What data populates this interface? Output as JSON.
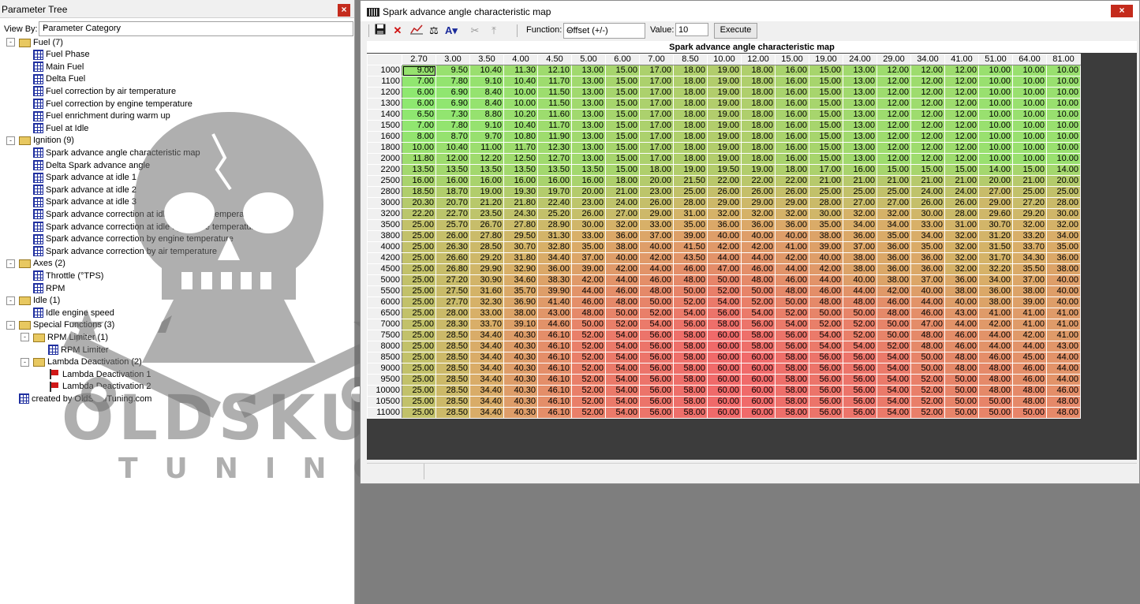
{
  "left_pane": {
    "title": "Parameter Tree",
    "view_by_label": "View By:",
    "view_by_value": "Parameter Category",
    "tree": [
      {
        "label": "Fuel (7)",
        "icon": "folder-icon",
        "level": 0,
        "toggle": "-"
      },
      {
        "label": "Fuel Phase",
        "icon": "map-grid-icon",
        "level": 1
      },
      {
        "label": "Main Fuel",
        "icon": "map-grid-icon",
        "level": 1
      },
      {
        "label": "Delta Fuel",
        "icon": "map-grid-icon",
        "level": 1
      },
      {
        "label": "Fuel correction by air temperature",
        "icon": "map-grid-icon",
        "level": 1
      },
      {
        "label": "Fuel correction by engine temperature",
        "icon": "map-grid-icon",
        "level": 1
      },
      {
        "label": "Fuel enrichment during warm up",
        "icon": "map-grid-icon",
        "level": 1
      },
      {
        "label": "Fuel at Idle",
        "icon": "map-grid-icon",
        "level": 1
      },
      {
        "label": "Ignition (9)",
        "icon": "folder-icon",
        "level": 0,
        "toggle": "-"
      },
      {
        "label": "Spark advance angle characteristic map",
        "icon": "map-grid-icon",
        "level": 1
      },
      {
        "label": "Delta Spark advance angle",
        "icon": "map-grid-icon",
        "level": 1
      },
      {
        "label": "Spark advance at idle 1",
        "icon": "map-grid-icon",
        "level": 1
      },
      {
        "label": "Spark advance at idle 2",
        "icon": "map-grid-icon",
        "level": 1
      },
      {
        "label": "Spark advance at idle 3",
        "icon": "map-grid-icon",
        "level": 1
      },
      {
        "label": "Spark advance correction at idle by engine temperature 1",
        "icon": "map-grid-icon",
        "level": 1
      },
      {
        "label": "Spark advance correction at idle by engine temperature 2",
        "icon": "map-grid-icon",
        "level": 1
      },
      {
        "label": "Spark advance correction by engine temperature",
        "icon": "map-grid-icon",
        "level": 1
      },
      {
        "label": "Spark advance correction by air temperature",
        "icon": "map-grid-icon",
        "level": 1
      },
      {
        "label": "Axes (2)",
        "icon": "folder-icon",
        "level": 0,
        "toggle": "-"
      },
      {
        "label": "Throttle (°TPS)",
        "icon": "map-grid-icon",
        "level": 1
      },
      {
        "label": "RPM",
        "icon": "map-grid-icon",
        "level": 1
      },
      {
        "label": "Idle (1)",
        "icon": "folder-icon",
        "level": 0,
        "toggle": "-"
      },
      {
        "label": "Idle engine speed",
        "icon": "map-grid-icon",
        "level": 1
      },
      {
        "label": "Special Functions (3)",
        "icon": "folder-icon",
        "level": 0,
        "toggle": "-"
      },
      {
        "label": "RPM Limiter (1)",
        "icon": "folder-icon",
        "level": 1,
        "toggle": "-"
      },
      {
        "label": "RPM Limiter",
        "icon": "map-grid-icon",
        "level": 2
      },
      {
        "label": "Lambda Deactivation (2)",
        "icon": "folder-icon",
        "level": 1,
        "toggle": "-"
      },
      {
        "label": "Lambda Deactivation 1",
        "icon": "red-flag-icon",
        "level": 2
      },
      {
        "label": "Lambda Deactivation 2",
        "icon": "red-flag-icon",
        "level": 2
      },
      {
        "label": "created by OldSkullTuning.com",
        "icon": "map-grid-icon",
        "level": 0
      }
    ],
    "watermark_letters": "OLDSKULL",
    "watermark_sub": "TUNING"
  },
  "map_window": {
    "title": "Spark advance angle characteristic map",
    "function_label": "Function:",
    "function_value": "Offset (+/-)",
    "value_label": "Value:",
    "value_input": "10",
    "execute_label": "Execute",
    "toolbar_icons": [
      "save-icon",
      "delete-icon",
      "graph-icon",
      "balance-icon",
      "text-tool-icon",
      "cut-icon",
      "interpolate-icon"
    ],
    "map_title": "Spark advance angle characteristic map",
    "x_axis": [
      "2.70",
      "3.00",
      "3.50",
      "4.00",
      "4.50",
      "5.00",
      "6.00",
      "7.00",
      "8.50",
      "10.00",
      "12.00",
      "15.00",
      "19.00",
      "24.00",
      "29.00",
      "34.00",
      "41.00",
      "51.00",
      "64.00",
      "81.00"
    ],
    "y_axis": [
      "1000",
      "1100",
      "1200",
      "1300",
      "1400",
      "1500",
      "1600",
      "1800",
      "2000",
      "2200",
      "2500",
      "2800",
      "3000",
      "3200",
      "3500",
      "3800",
      "4000",
      "4200",
      "4500",
      "5000",
      "5500",
      "6000",
      "6500",
      "7000",
      "7500",
      "8000",
      "8500",
      "9000",
      "9500",
      "10000",
      "10500",
      "11000"
    ],
    "values": [
      [
        "9.00",
        "9.50",
        "10.40",
        "11.30",
        "12.10",
        "13.00",
        "15.00",
        "17.00",
        "18.00",
        "19.00",
        "18.00",
        "16.00",
        "15.00",
        "13.00",
        "12.00",
        "12.00",
        "12.00",
        "10.00",
        "10.00",
        "10.00"
      ],
      [
        "7.00",
        "7.80",
        "9.10",
        "10.40",
        "11.70",
        "13.00",
        "15.00",
        "17.00",
        "18.00",
        "19.00",
        "18.00",
        "16.00",
        "15.00",
        "13.00",
        "12.00",
        "12.00",
        "12.00",
        "10.00",
        "10.00",
        "10.00"
      ],
      [
        "6.00",
        "6.90",
        "8.40",
        "10.00",
        "11.50",
        "13.00",
        "15.00",
        "17.00",
        "18.00",
        "19.00",
        "18.00",
        "16.00",
        "15.00",
        "13.00",
        "12.00",
        "12.00",
        "12.00",
        "10.00",
        "10.00",
        "10.00"
      ],
      [
        "6.00",
        "6.90",
        "8.40",
        "10.00",
        "11.50",
        "13.00",
        "15.00",
        "17.00",
        "18.00",
        "19.00",
        "18.00",
        "16.00",
        "15.00",
        "13.00",
        "12.00",
        "12.00",
        "12.00",
        "10.00",
        "10.00",
        "10.00"
      ],
      [
        "6.50",
        "7.30",
        "8.80",
        "10.20",
        "11.60",
        "13.00",
        "15.00",
        "17.00",
        "18.00",
        "19.00",
        "18.00",
        "16.00",
        "15.00",
        "13.00",
        "12.00",
        "12.00",
        "12.00",
        "10.00",
        "10.00",
        "10.00"
      ],
      [
        "7.00",
        "7.80",
        "9.10",
        "10.40",
        "11.70",
        "13.00",
        "15.00",
        "17.00",
        "18.00",
        "19.00",
        "18.00",
        "16.00",
        "15.00",
        "13.00",
        "12.00",
        "12.00",
        "12.00",
        "10.00",
        "10.00",
        "10.00"
      ],
      [
        "8.00",
        "8.70",
        "9.70",
        "10.80",
        "11.90",
        "13.00",
        "15.00",
        "17.00",
        "18.00",
        "19.00",
        "18.00",
        "16.00",
        "15.00",
        "13.00",
        "12.00",
        "12.00",
        "12.00",
        "10.00",
        "10.00",
        "10.00"
      ],
      [
        "10.00",
        "10.40",
        "11.00",
        "11.70",
        "12.30",
        "13.00",
        "15.00",
        "17.00",
        "18.00",
        "19.00",
        "18.00",
        "16.00",
        "15.00",
        "13.00",
        "12.00",
        "12.00",
        "12.00",
        "10.00",
        "10.00",
        "10.00"
      ],
      [
        "11.80",
        "12.00",
        "12.20",
        "12.50",
        "12.70",
        "13.00",
        "15.00",
        "17.00",
        "18.00",
        "19.00",
        "18.00",
        "16.00",
        "15.00",
        "13.00",
        "12.00",
        "12.00",
        "12.00",
        "10.00",
        "10.00",
        "10.00"
      ],
      [
        "13.50",
        "13.50",
        "13.50",
        "13.50",
        "13.50",
        "13.50",
        "15.00",
        "18.00",
        "19.00",
        "19.50",
        "19.00",
        "18.00",
        "17.00",
        "16.00",
        "15.00",
        "15.00",
        "15.00",
        "14.00",
        "15.00",
        "14.00"
      ],
      [
        "16.00",
        "16.00",
        "16.00",
        "16.00",
        "16.00",
        "16.00",
        "18.00",
        "20.00",
        "21.50",
        "22.00",
        "22.00",
        "22.00",
        "21.00",
        "21.00",
        "21.00",
        "21.00",
        "21.00",
        "20.00",
        "21.00",
        "20.00"
      ],
      [
        "18.50",
        "18.70",
        "19.00",
        "19.30",
        "19.70",
        "20.00",
        "21.00",
        "23.00",
        "25.00",
        "26.00",
        "26.00",
        "26.00",
        "25.00",
        "25.00",
        "25.00",
        "24.00",
        "24.00",
        "27.00",
        "25.00",
        "25.00"
      ],
      [
        "20.30",
        "20.70",
        "21.20",
        "21.80",
        "22.40",
        "23.00",
        "24.00",
        "26.00",
        "28.00",
        "29.00",
        "29.00",
        "29.00",
        "28.00",
        "27.00",
        "27.00",
        "26.00",
        "26.00",
        "29.00",
        "27.20",
        "28.00"
      ],
      [
        "22.20",
        "22.70",
        "23.50",
        "24.30",
        "25.20",
        "26.00",
        "27.00",
        "29.00",
        "31.00",
        "32.00",
        "32.00",
        "32.00",
        "30.00",
        "32.00",
        "32.00",
        "30.00",
        "28.00",
        "29.60",
        "29.20",
        "30.00"
      ],
      [
        "25.00",
        "25.70",
        "26.70",
        "27.80",
        "28.90",
        "30.00",
        "32.00",
        "33.00",
        "35.00",
        "36.00",
        "36.00",
        "36.00",
        "35.00",
        "34.00",
        "34.00",
        "33.00",
        "31.00",
        "30.70",
        "32.00",
        "32.00"
      ],
      [
        "25.00",
        "26.00",
        "27.80",
        "29.50",
        "31.30",
        "33.00",
        "36.00",
        "37.00",
        "39.00",
        "40.00",
        "40.00",
        "40.00",
        "38.00",
        "36.00",
        "35.00",
        "34.00",
        "32.00",
        "31.20",
        "33.20",
        "34.00"
      ],
      [
        "25.00",
        "26.30",
        "28.50",
        "30.70",
        "32.80",
        "35.00",
        "38.00",
        "40.00",
        "41.50",
        "42.00",
        "42.00",
        "41.00",
        "39.00",
        "37.00",
        "36.00",
        "35.00",
        "32.00",
        "31.50",
        "33.70",
        "35.00"
      ],
      [
        "25.00",
        "26.60",
        "29.20",
        "31.80",
        "34.40",
        "37.00",
        "40.00",
        "42.00",
        "43.50",
        "44.00",
        "44.00",
        "42.00",
        "40.00",
        "38.00",
        "36.00",
        "36.00",
        "32.00",
        "31.70",
        "34.30",
        "36.00"
      ],
      [
        "25.00",
        "26.80",
        "29.90",
        "32.90",
        "36.00",
        "39.00",
        "42.00",
        "44.00",
        "46.00",
        "47.00",
        "46.00",
        "44.00",
        "42.00",
        "38.00",
        "36.00",
        "36.00",
        "32.00",
        "32.20",
        "35.50",
        "38.00"
      ],
      [
        "25.00",
        "27.20",
        "30.90",
        "34.60",
        "38.30",
        "42.00",
        "44.00",
        "46.00",
        "48.00",
        "50.00",
        "48.00",
        "46.00",
        "44.00",
        "40.00",
        "38.00",
        "37.00",
        "36.00",
        "34.00",
        "37.00",
        "40.00"
      ],
      [
        "25.00",
        "27.50",
        "31.60",
        "35.70",
        "39.90",
        "44.00",
        "46.00",
        "48.00",
        "50.00",
        "52.00",
        "50.00",
        "48.00",
        "46.00",
        "44.00",
        "42.00",
        "40.00",
        "38.00",
        "36.00",
        "38.00",
        "40.00"
      ],
      [
        "25.00",
        "27.70",
        "32.30",
        "36.90",
        "41.40",
        "46.00",
        "48.00",
        "50.00",
        "52.00",
        "54.00",
        "52.00",
        "50.00",
        "48.00",
        "48.00",
        "46.00",
        "44.00",
        "40.00",
        "38.00",
        "39.00",
        "40.00"
      ],
      [
        "25.00",
        "28.00",
        "33.00",
        "38.00",
        "43.00",
        "48.00",
        "50.00",
        "52.00",
        "54.00",
        "56.00",
        "54.00",
        "52.00",
        "50.00",
        "50.00",
        "48.00",
        "46.00",
        "43.00",
        "41.00",
        "41.00",
        "41.00"
      ],
      [
        "25.00",
        "28.30",
        "33.70",
        "39.10",
        "44.60",
        "50.00",
        "52.00",
        "54.00",
        "56.00",
        "58.00",
        "56.00",
        "54.00",
        "52.00",
        "52.00",
        "50.00",
        "47.00",
        "44.00",
        "42.00",
        "41.00",
        "41.00"
      ],
      [
        "25.00",
        "28.50",
        "34.40",
        "40.30",
        "46.10",
        "52.00",
        "54.00",
        "56.00",
        "58.00",
        "60.00",
        "58.00",
        "56.00",
        "54.00",
        "52.00",
        "50.00",
        "48.00",
        "46.00",
        "44.00",
        "42.00",
        "41.00"
      ],
      [
        "25.00",
        "28.50",
        "34.40",
        "40.30",
        "46.10",
        "52.00",
        "54.00",
        "56.00",
        "58.00",
        "60.00",
        "58.00",
        "56.00",
        "54.00",
        "54.00",
        "52.00",
        "48.00",
        "46.00",
        "44.00",
        "44.00",
        "43.00"
      ],
      [
        "25.00",
        "28.50",
        "34.40",
        "40.30",
        "46.10",
        "52.00",
        "54.00",
        "56.00",
        "58.00",
        "60.00",
        "60.00",
        "58.00",
        "56.00",
        "56.00",
        "54.00",
        "50.00",
        "48.00",
        "46.00",
        "45.00",
        "44.00"
      ],
      [
        "25.00",
        "28.50",
        "34.40",
        "40.30",
        "46.10",
        "52.00",
        "54.00",
        "56.00",
        "58.00",
        "60.00",
        "60.00",
        "58.00",
        "56.00",
        "56.00",
        "54.00",
        "50.00",
        "48.00",
        "48.00",
        "46.00",
        "44.00"
      ],
      [
        "25.00",
        "28.50",
        "34.40",
        "40.30",
        "46.10",
        "52.00",
        "54.00",
        "56.00",
        "58.00",
        "60.00",
        "60.00",
        "58.00",
        "56.00",
        "56.00",
        "54.00",
        "52.00",
        "50.00",
        "48.00",
        "46.00",
        "44.00"
      ],
      [
        "25.00",
        "28.50",
        "34.40",
        "40.30",
        "46.10",
        "52.00",
        "54.00",
        "56.00",
        "58.00",
        "60.00",
        "60.00",
        "58.00",
        "56.00",
        "56.00",
        "54.00",
        "52.00",
        "50.00",
        "48.00",
        "48.00",
        "46.00"
      ],
      [
        "25.00",
        "28.50",
        "34.40",
        "40.30",
        "46.10",
        "52.00",
        "54.00",
        "56.00",
        "58.00",
        "60.00",
        "60.00",
        "58.00",
        "56.00",
        "56.00",
        "54.00",
        "52.00",
        "50.00",
        "50.00",
        "48.00",
        "48.00"
      ],
      [
        "25.00",
        "28.50",
        "34.40",
        "40.30",
        "46.10",
        "52.00",
        "54.00",
        "56.00",
        "58.00",
        "60.00",
        "60.00",
        "58.00",
        "56.00",
        "56.00",
        "54.00",
        "52.00",
        "50.00",
        "50.00",
        "50.00",
        "48.00"
      ]
    ],
    "color_scale": {
      "low": "#8ee870",
      "mid": "#d8b068",
      "high": "#f06a6a",
      "min": 6,
      "max": 60
    },
    "selected_cell": "1000 × 2.70"
  }
}
